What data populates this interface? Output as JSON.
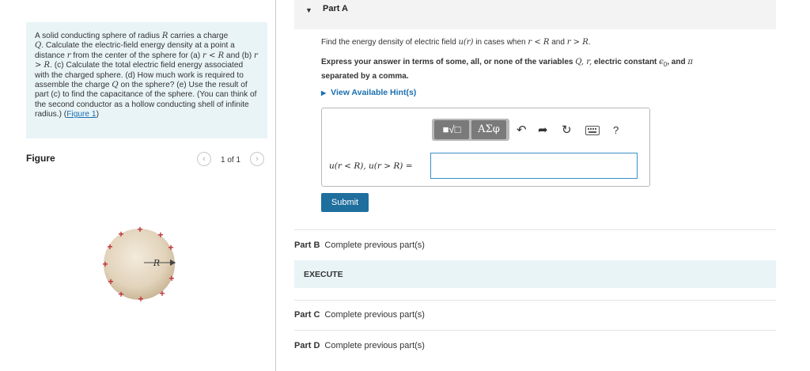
{
  "problem": {
    "t1": "A solid conducting sphere of radius ",
    "R": "R",
    "t2": " carries a charge",
    "Q": "Q",
    "t3": ". Calculate the electric-field energy density at a point a distance ",
    "r": "r",
    "t4": " from the center of the sphere for (a) ",
    "cond_lt": "r < R",
    "t5": " and (b) ",
    "cond_gt": "r > R",
    "t6": ". (c) Calculate the total electric field energy associated with the charged sphere. (d) How much work is required to assemble the charge ",
    "Q2": "Q",
    "t7": " on the sphere? (e) Use the result of part (c) to find the capacitance of the sphere. (You can think of the second conductor as a hollow conducting shell of infinite radius.) (",
    "link": "Figure 1",
    "t8": ")"
  },
  "figure": {
    "title": "Figure",
    "pager": "1 of 1",
    "prev_icon": "chevron-left-icon",
    "next_icon": "chevron-right-icon",
    "radius_label": "R",
    "charge_symbol": "+"
  },
  "part_a": {
    "title": "Part A",
    "instruction_pre": "Find the energy density of electric field ",
    "u_of_r": "u(r)",
    "instruction_mid": " in cases when ",
    "c1": "r < R",
    "and": " and ",
    "c2": "r > R",
    "end": ".",
    "express_pre": "Express your answer in terms of some, all, or none of the variables ",
    "vars": "Q, r,",
    "express_mid": " electric constant ",
    "eps": "ϵ",
    "eps_sub": "0",
    "express_mid2": ", and ",
    "pi": "π",
    "express_end": " separated by a comma.",
    "hint_label": "View Available Hint(s)",
    "toolbar": {
      "matrix_label": "■√□",
      "greek_label": "ΑΣφ",
      "undo_icon": "undo-icon",
      "redo_icon": "redo-icon",
      "reset_icon": "reset-icon",
      "keyboard_icon": "keyboard-icon",
      "help_label": "?"
    },
    "answer_label": "u(r < R), u(r > R) =",
    "answer_value": "",
    "submit_label": "Submit"
  },
  "part_b": {
    "title": "Part B",
    "status": "Complete previous part(s)"
  },
  "execute": {
    "label": "EXECUTE"
  },
  "part_c": {
    "title": "Part C",
    "status": "Complete previous part(s)"
  },
  "part_d": {
    "title": "Part D",
    "status": "Complete previous part(s)"
  },
  "colors": {
    "accent": "#1a6fb0",
    "submit": "#1f6f9e",
    "panel_bg": "#e9f4f7",
    "header_bg": "#f3f3f3",
    "charge": "#c0303a"
  }
}
